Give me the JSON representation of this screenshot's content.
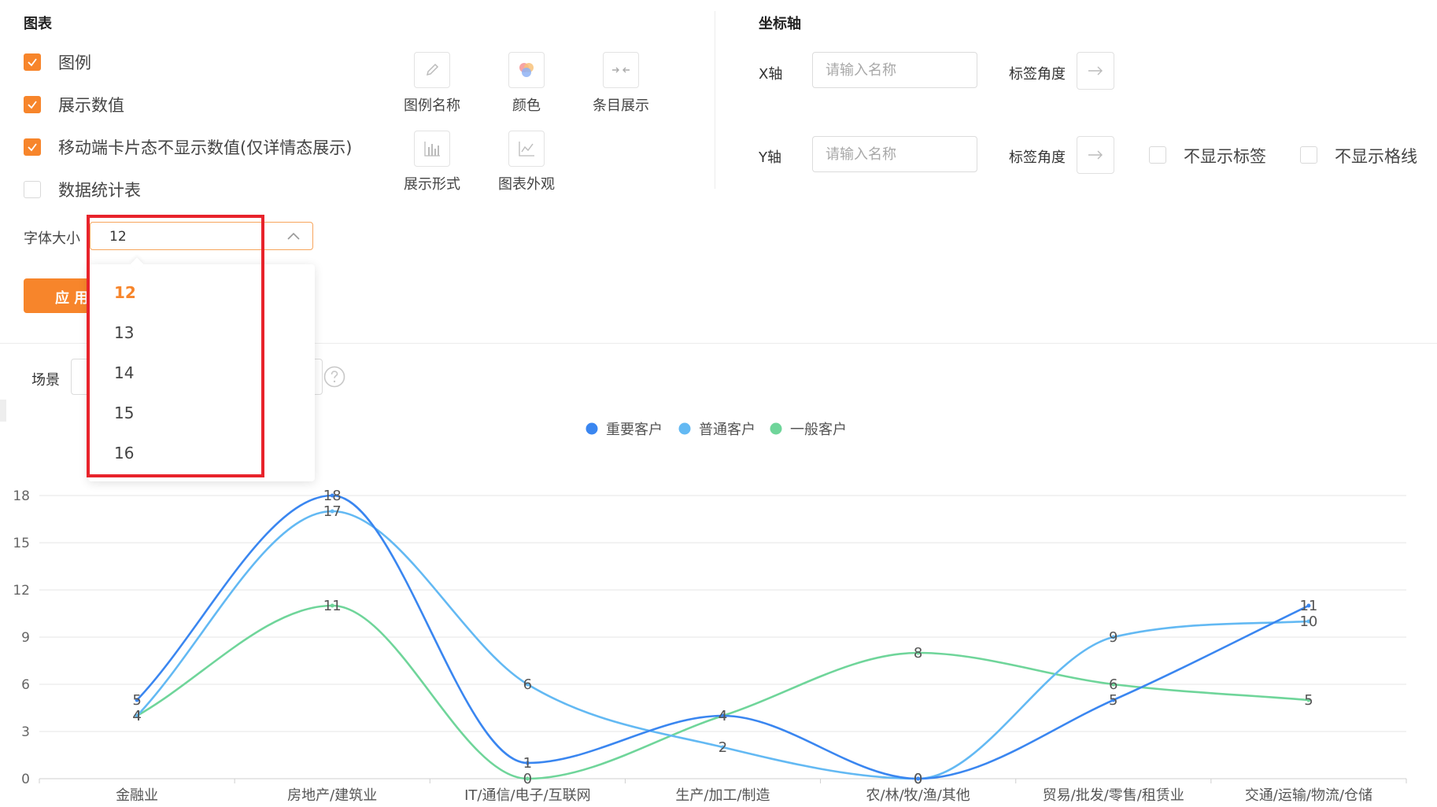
{
  "chart_section": {
    "title": "图表",
    "checkboxes": [
      {
        "label": "图例",
        "checked": true
      },
      {
        "label": "展示数值",
        "checked": true
      },
      {
        "label": "移动端卡片态不显示数值(仅详情态展示)",
        "checked": true
      },
      {
        "label": "数据统计表",
        "checked": false
      }
    ],
    "font_size_label": "字体大小",
    "font_size_value": "12",
    "apply_label": "应 用",
    "tools": [
      {
        "label": "图例名称",
        "icon": "pencil-icon"
      },
      {
        "label": "颜色",
        "icon": "color-palette-icon"
      },
      {
        "label": "条目展示",
        "icon": "compress-arrows-icon"
      },
      {
        "label": "展示形式",
        "icon": "bar-chart-icon"
      },
      {
        "label": "图表外观",
        "icon": "line-chart-icon"
      }
    ]
  },
  "axis_section": {
    "title": "坐标轴",
    "x_label": "X轴",
    "y_label": "Y轴",
    "name_placeholder": "请输入名称",
    "tick_angle_label": "标签角度",
    "hide_labels": "不显示标签",
    "hide_grid": "不显示格线"
  },
  "scene_label": "场景",
  "dropdown": {
    "options": [
      "12",
      "13",
      "14",
      "15",
      "16"
    ],
    "selected": "12"
  },
  "colors": {
    "accent": "#f7852b",
    "highlight_box": "#e8232b",
    "series_important": "#3a86f0",
    "series_normal": "#63b9f3",
    "series_general": "#6fd59a"
  },
  "chart_data": {
    "type": "line",
    "categories": [
      "金融业",
      "房地产/建筑业",
      "IT/通信/电子/互联网",
      "生产/加工/制造",
      "农/林/牧/渔/其他",
      "贸易/批发/零售/租赁业",
      "交通/运输/物流/仓储"
    ],
    "series": [
      {
        "name": "重要客户",
        "values": [
          5,
          18,
          1,
          4,
          0,
          5,
          11
        ]
      },
      {
        "name": "普通客户",
        "values": [
          4,
          17,
          6,
          2,
          0,
          9,
          10
        ]
      },
      {
        "name": "一般客户",
        "values": [
          4,
          11,
          0,
          4,
          8,
          6,
          5
        ]
      }
    ],
    "yticks": [
      "0",
      "3",
      "6",
      "9",
      "12",
      "15",
      "18"
    ],
    "ylim": [
      0,
      18
    ],
    "legend": "top-center",
    "grid": true,
    "smooth": true
  }
}
